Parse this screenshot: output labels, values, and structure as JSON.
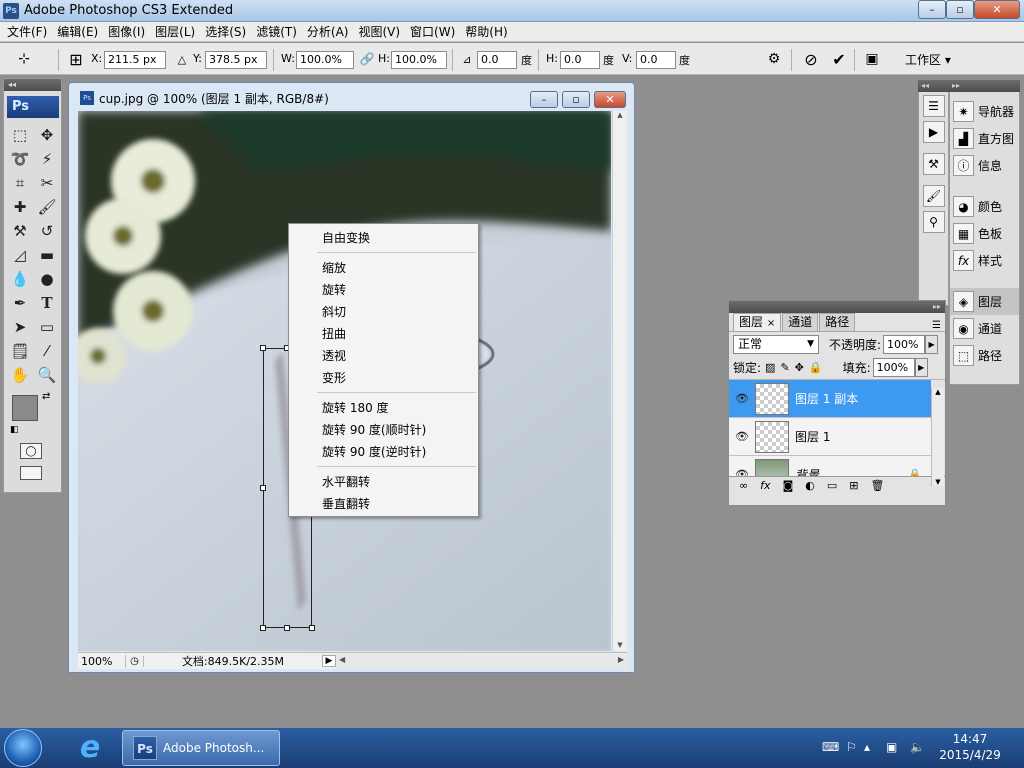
{
  "app": {
    "title": "Adobe Photoshop CS3 Extended",
    "icon_label": "Ps"
  },
  "window_controls": {
    "minimize": "–",
    "maximize": "▫",
    "close": "✕"
  },
  "menu": [
    "文件(F)",
    "编辑(E)",
    "图像(I)",
    "图层(L)",
    "选择(S)",
    "滤镜(T)",
    "分析(A)",
    "视图(V)",
    "窗口(W)",
    "帮助(H)"
  ],
  "options": {
    "x_label": "X:",
    "x_value": "211.5 px",
    "y_label": "Y:",
    "y_value": "378.5 px",
    "w_label": "W:",
    "w_value": "100.0%",
    "h_label": "H:",
    "h_value": "100.0%",
    "angle_value": "0.0",
    "angle_unit": "度",
    "hskew_label": "H:",
    "hskew_value": "0.0",
    "hskew_unit": "度",
    "vskew_label": "V:",
    "vskew_value": "0.0",
    "vskew_unit": "度",
    "workspace": "工作区 ▾"
  },
  "toolbox": {
    "logo": "Ps"
  },
  "document": {
    "title": "cup.jpg @ 100% (图层 1 副本, RGB/8#)",
    "zoom": "100%",
    "doc_info": "文档:849.5K/2.35M"
  },
  "context_menu": {
    "group1": [
      "自由变换"
    ],
    "group2": [
      "缩放",
      "旋转",
      "斜切",
      "扭曲",
      "透视",
      "变形"
    ],
    "group3": [
      "旋转 180 度",
      "旋转 90 度(顺时针)",
      "旋转 90 度(逆时针)"
    ],
    "group4": [
      "水平翻转",
      "垂直翻转"
    ]
  },
  "right_panel": {
    "group1": [
      "导航器",
      "直方图",
      "信息"
    ],
    "group2": [
      "颜色",
      "色板",
      "样式"
    ],
    "group3": [
      "图层",
      "通道",
      "路径"
    ]
  },
  "layers_panel": {
    "tabs": [
      "图层",
      "通道",
      "路径"
    ],
    "blend_mode": "正常",
    "opacity_label": "不透明度:",
    "opacity_value": "100%",
    "lock_label": "锁定:",
    "fill_label": "填充:",
    "fill_value": "100%",
    "layers": [
      "图层 1 副本",
      "图层 1",
      "背景"
    ]
  },
  "taskbar": {
    "task_label": "Adobe Photosh...",
    "time": "14:47",
    "date": "2015/4/29"
  }
}
